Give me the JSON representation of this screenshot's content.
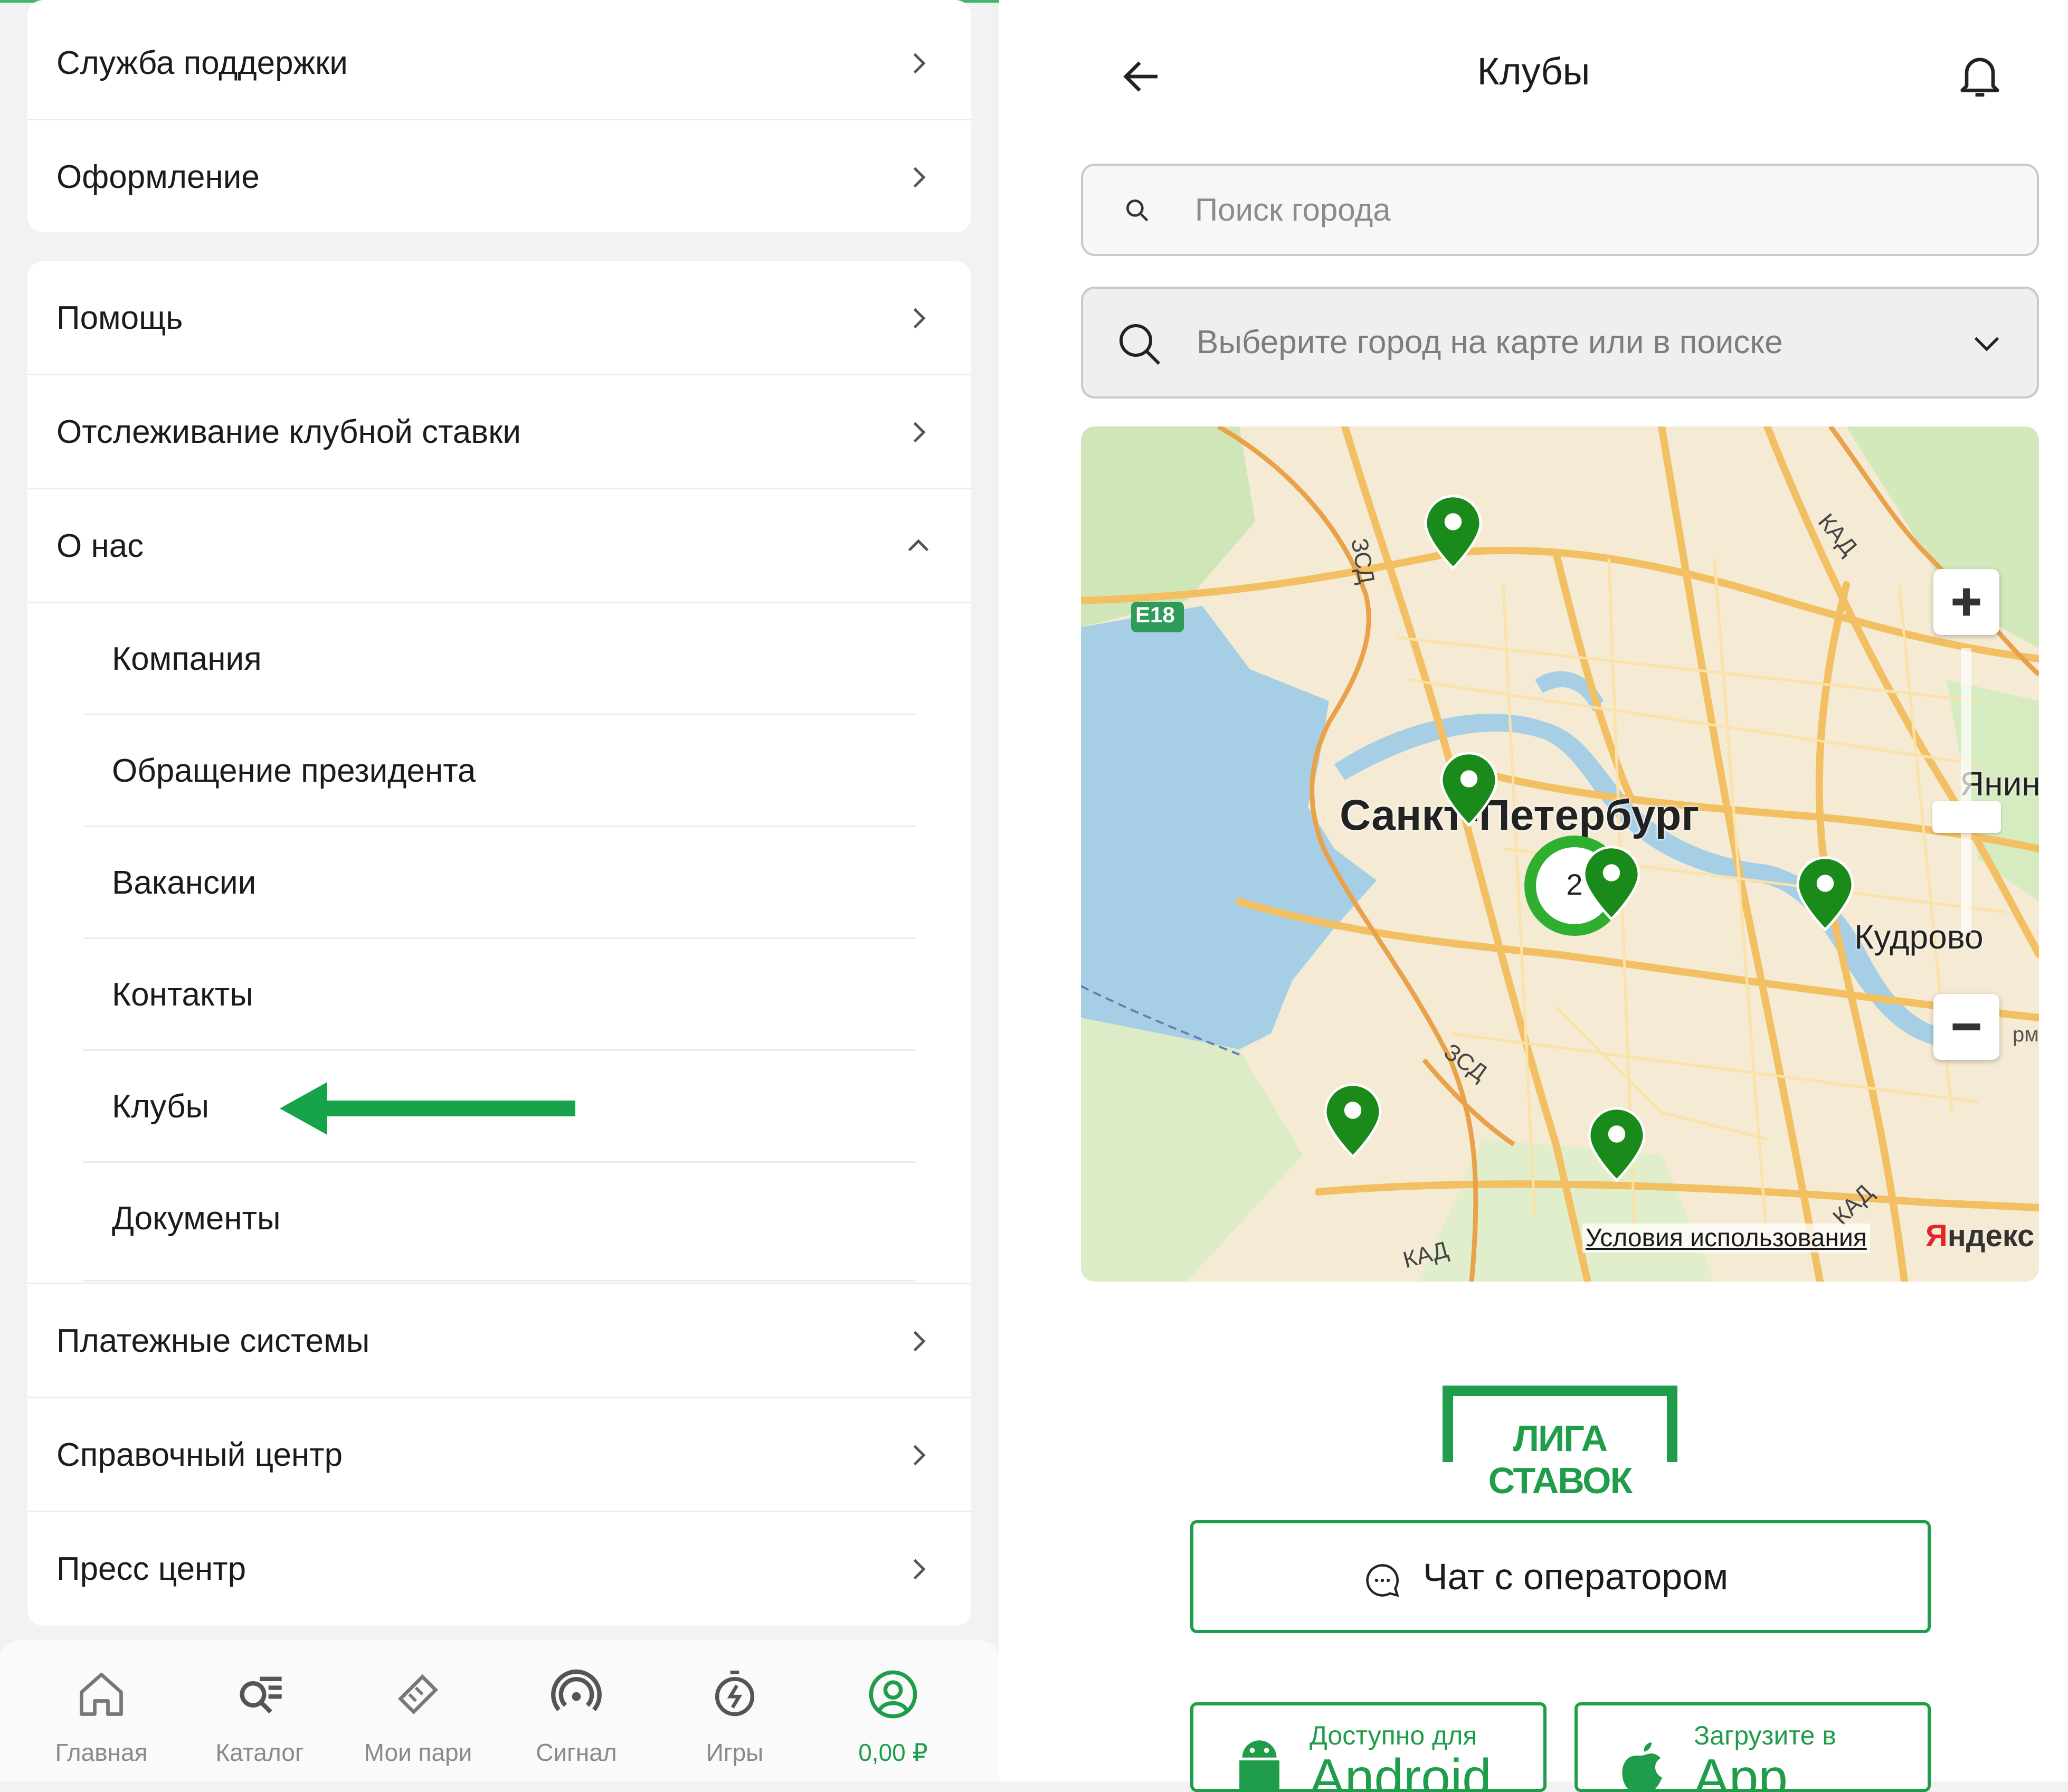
{
  "menu": {
    "card1": [
      {
        "label": "Служба поддержки"
      },
      {
        "label": "Оформление"
      }
    ],
    "card2_rows": [
      {
        "label": "Помощь"
      },
      {
        "label": "Отслеживание клубной ставки"
      },
      {
        "label": "О нас"
      }
    ],
    "about_sub": [
      {
        "label": "Компания"
      },
      {
        "label": "Обращение президента"
      },
      {
        "label": "Вакансии"
      },
      {
        "label": "Контакты"
      },
      {
        "label": "Клубы"
      },
      {
        "label": "Документы"
      }
    ],
    "card2_bottom": [
      {
        "label": "Платежные системы"
      },
      {
        "label": "Справочный центр"
      },
      {
        "label": "Пресс центр"
      }
    ]
  },
  "bottom_nav": [
    {
      "label": "Главная",
      "icon": "home-icon"
    },
    {
      "label": "Каталог",
      "icon": "catalog-search-icon"
    },
    {
      "label": "Мои пари",
      "icon": "ticket-icon"
    },
    {
      "label": "Сигнал",
      "icon": "signal-icon"
    },
    {
      "label": "Игры",
      "icon": "stopwatch-icon"
    },
    {
      "label": "0,00 ₽",
      "icon": "profile-icon",
      "active": true
    }
  ],
  "clubs": {
    "title": "Клубы",
    "search_placeholder": "Поиск города",
    "city_select_placeholder": "Выберите город на карте или в поиске",
    "map": {
      "labels": {
        "city": "Санкт-Петербург",
        "kudrovo": "Кудрово",
        "yanino": "Янин",
        "road_e18": "E18",
        "zsd1": "ЗСД",
        "zsd2": "ЗСД",
        "kad1": "КАД",
        "kad2": "КАД",
        "kad3": "КАД",
        "urm": "рм"
      },
      "cluster_count": "2",
      "terms": "Условия использования",
      "provider_first": "Я",
      "provider_rest": "ндекс"
    },
    "logo_text": "ЛИГА СТАВОК",
    "chat_button": "Чат с оператором",
    "android": {
      "small": "Доступно для",
      "big": "Android"
    },
    "appstore": {
      "small": "Загрузите в",
      "big": "App Store"
    }
  },
  "colors": {
    "brand_green": "#1f9d4a",
    "arrow_green": "#16a34a"
  }
}
